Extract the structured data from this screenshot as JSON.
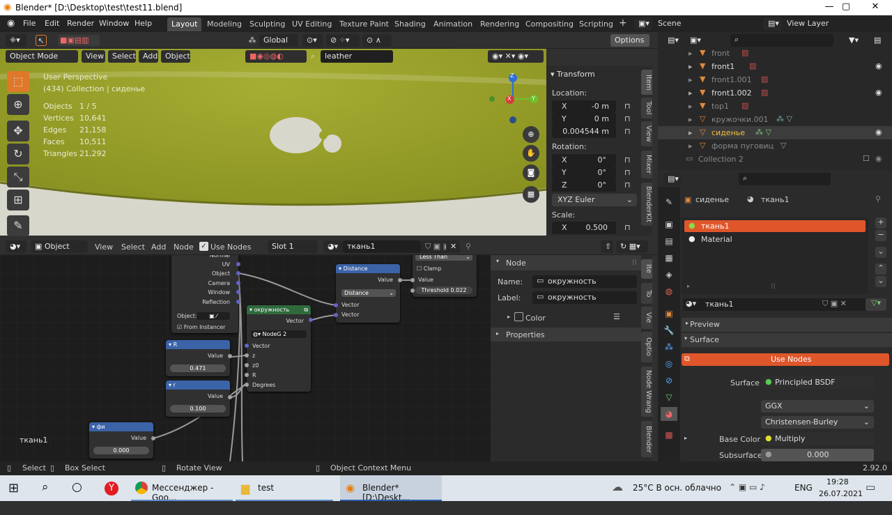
{
  "window": {
    "title": "Blender* [D:\\Desktop\\test\\test11.blend]",
    "minimize": "—",
    "maximize": "▢",
    "close": "✕"
  },
  "menu": [
    "File",
    "Edit",
    "Render",
    "Window",
    "Help"
  ],
  "workspaces": [
    "Layout",
    "Modeling",
    "Sculpting",
    "UV Editing",
    "Texture Paint",
    "Shading",
    "Animation",
    "Rendering",
    "Compositing",
    "Scripting"
  ],
  "workspace_add": "+",
  "scene": {
    "label": "Scene",
    "view_layer": "View Layer"
  },
  "viewport_toolbar": {
    "transform": "Global",
    "options": "Options",
    "search_value": "leather"
  },
  "viewport_header": {
    "mode": "Object Mode",
    "items": [
      "View",
      "Select",
      "Add",
      "Object"
    ]
  },
  "viewport_info": {
    "perspective": "User Perspective",
    "collection": "(434) Collection | сиденье",
    "stats": [
      {
        "label": "Objects",
        "value": "1 / 5"
      },
      {
        "label": "Vertices",
        "value": "10,641"
      },
      {
        "label": "Edges",
        "value": "21,158"
      },
      {
        "label": "Faces",
        "value": "10,511"
      },
      {
        "label": "Triangles",
        "value": "21,292"
      }
    ]
  },
  "gizmo": {
    "z": "Z",
    "x": "X",
    "y": "Y"
  },
  "transform_panel": {
    "title": "Transform",
    "location_label": "Location:",
    "location": [
      {
        "axis": "X",
        "value": "-0 m"
      },
      {
        "axis": "Y",
        "value": "0 m"
      },
      {
        "axis": "Z",
        "value": "0.004544 m"
      }
    ],
    "rotation_label": "Rotation:",
    "rotation": [
      {
        "axis": "X",
        "value": "0°"
      },
      {
        "axis": "Y",
        "value": "0°"
      },
      {
        "axis": "Z",
        "value": "0°"
      }
    ],
    "rotation_mode": "XYZ Euler",
    "scale_label": "Scale:",
    "scale": [
      {
        "axis": "X",
        "value": "0.500"
      }
    ]
  },
  "viewport_tabs": [
    "Item",
    "Tool",
    "View",
    "Mixer",
    "BlenderKit"
  ],
  "outliner": {
    "rows": [
      {
        "name": "front",
        "dim": true
      },
      {
        "name": "front1",
        "dim": false
      },
      {
        "name": "front1.001",
        "dim": true
      },
      {
        "name": "front1.002",
        "dim": false
      },
      {
        "name": "top1",
        "dim": true
      },
      {
        "name": "кружочки.001",
        "dim": true
      },
      {
        "name": "сиденье",
        "dim": false
      },
      {
        "name": "форма пуговиц",
        "dim": true
      },
      {
        "name": "Collection 2",
        "dim": true
      }
    ]
  },
  "properties": {
    "breadcrumb_object": "сиденье",
    "breadcrumb_material": "ткань1",
    "slots": [
      "ткань1",
      "Material"
    ],
    "material_name": "ткань1",
    "preview": "Preview",
    "surface_section": "Surface",
    "use_nodes": "Use Nodes",
    "surface_label": "Surface",
    "surface_value": "Principled BSDF",
    "distribution": "GGX",
    "subsurface_method": "Christensen-Burley",
    "base_color_label": "Base Color",
    "base_color_value": "Multiply",
    "subsurface_label": "Subsurface",
    "subsurface_value": "0.000"
  },
  "node_header": {
    "type": "Object",
    "items": [
      "View",
      "Select",
      "Add",
      "Node"
    ],
    "use_nodes": "Use Nodes",
    "slot": "Slot 1",
    "material": "ткань1"
  },
  "nodes": {
    "texcoord": {
      "outputs": [
        "Normal",
        "UV",
        "Object",
        "Camera",
        "Window",
        "Reflection"
      ],
      "object_label": "Object:",
      "from_instancer": "From Instancer"
    },
    "distance": {
      "title": "Distance",
      "output": "Value",
      "mode": "Distance",
      "inputs": [
        "Vector",
        "Vector"
      ]
    },
    "math": {
      "mode": "Less Than",
      "clamp": "Clamp",
      "value": "Value",
      "threshold_label": "Threshold",
      "threshold": "0.022"
    },
    "group": {
      "title": "окружность",
      "output": "Vector",
      "group_name": "NodeG",
      "users": "2",
      "inputs": [
        "Vector",
        "z",
        "z0",
        "R",
        "Degrees"
      ]
    },
    "r_upper": {
      "title": "R",
      "output": "Value",
      "value": "0.471"
    },
    "r_lower": {
      "title": "r",
      "output": "Value",
      "value": "0.100"
    },
    "phi": {
      "title": "фи",
      "output": "Value",
      "value": "0.000"
    }
  },
  "node_canvas_label": "ткань1",
  "node_panel": {
    "section": "Node",
    "name_label": "Name:",
    "name_value": "окружность",
    "label_label": "Label:",
    "label_value": "окружность",
    "color": "Color",
    "properties": "Properties"
  },
  "node_tabs": [
    "Ite",
    "To",
    "Vie",
    "Optio",
    "Node Wrang",
    "Blender"
  ],
  "status": {
    "select": "Select",
    "box_select": "Box Select",
    "rotate": "Rotate View",
    "context": "Object Context Menu",
    "version": "2.92.0"
  },
  "taskbar": {
    "apps": [
      {
        "label": "Мессенджер - Goo..."
      },
      {
        "label": "test"
      },
      {
        "label": "Blender* [D:\\Deskt..."
      }
    ],
    "weather": "25°C  В осн. облачно",
    "lang": "ENG",
    "time": "19:28",
    "date": "26.07.2021"
  }
}
